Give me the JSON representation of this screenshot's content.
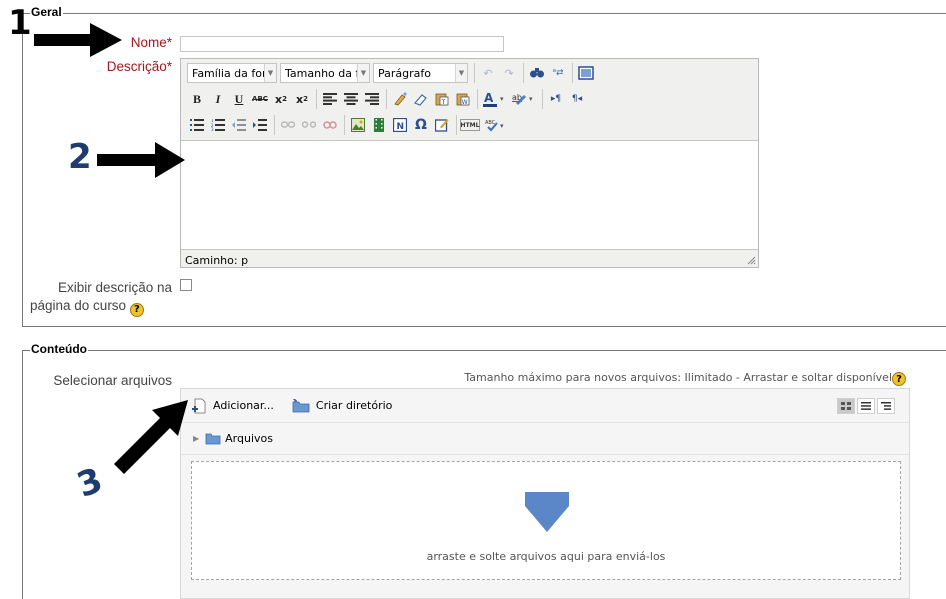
{
  "section_general": {
    "legend": "Geral",
    "name_label": "Nome",
    "name_value": "",
    "description_label": "Descrição",
    "required_mark": "*",
    "editor": {
      "font_family": "Família da font",
      "font_size": "Tamanho da fc",
      "format": "Parágrafo",
      "path_text": "Caminho: p"
    },
    "show_description_label_line1": "Exibir descrição na",
    "show_description_label_line2": "página do curso"
  },
  "section_content": {
    "legend": "Conteúdo",
    "select_files_label": "Selecionar arquivos",
    "max_size_text": "Tamanho máximo para novos arquivos: Ilimitado - Arrastar e soltar disponível",
    "add_label": "Adicionar...",
    "create_dir_label": "Criar diretório",
    "folder_label": "Arquivos",
    "drop_text": "arraste e solte arquivos aqui para enviá-los"
  },
  "annotations": {
    "n1": "1",
    "n2": "2",
    "n3": "3"
  },
  "colors": {
    "required": "#a0171c",
    "help": "#f2c12e",
    "drop_arrow": "#5b87c9",
    "folder": "#6a98d1"
  },
  "icons": [
    "help-icon",
    "undo-icon",
    "redo-icon",
    "find-icon",
    "replace-icon",
    "fullscreen-icon",
    "bold-icon",
    "italic-icon",
    "underline-icon",
    "strikethrough-icon",
    "subscript-icon",
    "superscript-icon",
    "align-left-icon",
    "align-center-icon",
    "align-right-icon",
    "cleanup-icon",
    "eraser-icon",
    "paste-text-icon",
    "paste-word-icon",
    "text-color-icon",
    "highlight-icon",
    "ltr-icon",
    "rtl-icon",
    "bullet-list-icon",
    "numbered-list-icon",
    "outdent-icon",
    "indent-icon",
    "link-icon",
    "unlink-icon",
    "anchor-icon",
    "image-icon",
    "media-icon",
    "emoticon-icon",
    "special-char-icon",
    "nonbreaking-icon",
    "html-icon",
    "spellcheck-icon",
    "add-file-icon",
    "folder-icon",
    "expand-icon",
    "grid-view-icon",
    "list-view-icon",
    "tree-view-icon",
    "drop-arrow-icon",
    "resize-grip-icon",
    "arrow-pointer-icon"
  ]
}
